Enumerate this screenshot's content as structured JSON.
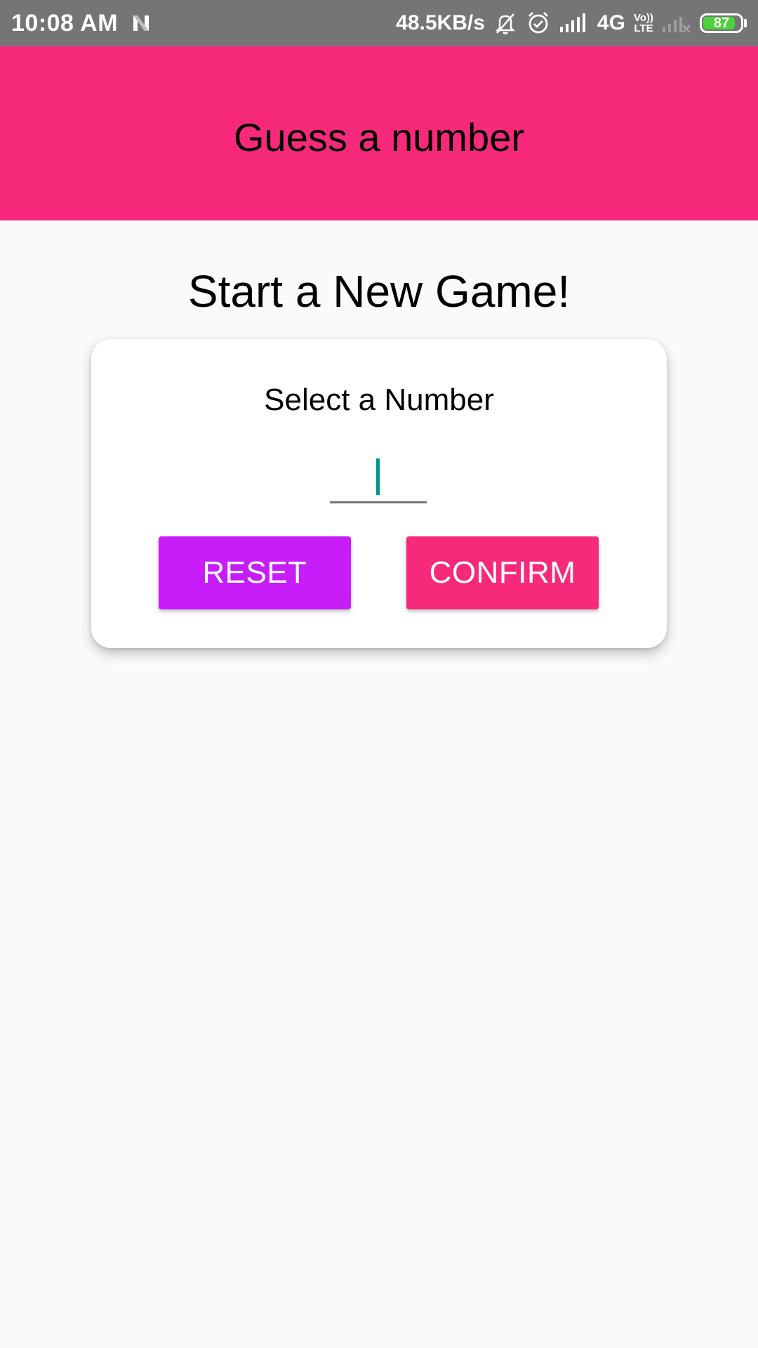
{
  "status_bar": {
    "time": "10:08 AM",
    "network_speed": "48.5KB/s",
    "network_type": "4G",
    "volte_top": "Vo))",
    "volte_bottom": "LTE",
    "battery": "87",
    "battery_level": 0.87,
    "icons": [
      "n-notification-icon",
      "bell-muted-icon",
      "alarm-icon",
      "signal-icon",
      "volte-icon",
      "signal-empty-icon",
      "battery-icon"
    ]
  },
  "app_bar": {
    "title": "Guess a number",
    "color": "#f7297b"
  },
  "main": {
    "title": "Start a New Game!",
    "card": {
      "label": "Select a Number",
      "input_value": "",
      "buttons": {
        "reset_label": "RESET",
        "confirm_label": "CONFIRM"
      }
    }
  },
  "colors": {
    "accent": "#f7297b",
    "reset_button": "#c61df9",
    "cursor": "#009688",
    "status_bar": "#757575"
  }
}
